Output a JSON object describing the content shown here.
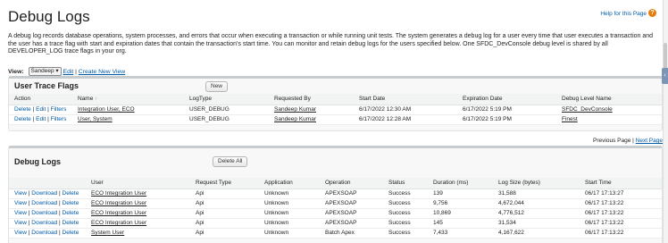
{
  "header": {
    "title": "Debug Logs",
    "help_link": "Help for this Page",
    "help_icon": "help-icon",
    "description": "A debug log records database operations, system processes, and errors that occur when executing a transaction or while running unit tests. The system generates a debug log for a user every time that user executes a transaction and the user has a trace flag with start and expiration dates that contain the transaction's start time. You can monitor and retain debug logs for the users specified below. One SFDC_DevConsole debug level is shared by all DEVELOPER_LOG trace flags in your org."
  },
  "view_bar": {
    "label": "View:",
    "selected": "Sandeep",
    "edit": "Edit",
    "separator": "|",
    "create": "Create New View"
  },
  "trace_flags": {
    "title": "User Trace Flags",
    "new_button": "New",
    "columns": [
      "Action",
      "Name",
      "LogType",
      "Requested By",
      "Start Date",
      "Expiration Date",
      "Debug Level Name"
    ],
    "sort_indicator": "↑",
    "rows": [
      {
        "actions": [
          "Delete",
          "Edit",
          "Filters"
        ],
        "name": "Integration User, ECO",
        "log_type": "USER_DEBUG",
        "requested_by": "Sandeep Kumar",
        "start": "6/17/2022 12:30 AM",
        "expiration": "6/17/2022 5:19 PM",
        "level": "SFDC_DevConsole"
      },
      {
        "actions": [
          "Delete",
          "Edit",
          "Filters"
        ],
        "name": "User, System",
        "log_type": "USER_DEBUG",
        "requested_by": "Sandeep Kumar",
        "start": "6/17/2022 12:28 AM",
        "expiration": "6/17/2022 5:19 PM",
        "level": "Finest"
      }
    ]
  },
  "pager": {
    "previous": "Previous Page",
    "separator": "|",
    "next": "Next Page"
  },
  "debug_logs": {
    "title": "Debug Logs",
    "delete_all_button": "Delete All",
    "columns": [
      "",
      "User",
      "Request Type",
      "Application",
      "Operation",
      "Status",
      "Duration (ms)",
      "Log Size (bytes)",
      "Start Time"
    ],
    "rows": [
      {
        "actions": [
          "View",
          "Download",
          "Delete"
        ],
        "user": "ECO Integration User",
        "request": "Api",
        "app": "Unknown",
        "op": "APEXSOAP",
        "status": "Success",
        "duration": "139",
        "size": "31,588",
        "start": "06/17 17:13:27"
      },
      {
        "actions": [
          "View",
          "Download",
          "Delete"
        ],
        "user": "ECO Integration User",
        "request": "Api",
        "app": "Unknown",
        "op": "APEXSOAP",
        "status": "Success",
        "duration": "9,756",
        "size": "4,672,044",
        "start": "06/17 17:13:22"
      },
      {
        "actions": [
          "View",
          "Download",
          "Delete"
        ],
        "user": "ECO Integration User",
        "request": "Api",
        "app": "Unknown",
        "op": "APEXSOAP",
        "status": "Success",
        "duration": "10,869",
        "size": "4,776,512",
        "start": "06/17 17:13:22"
      },
      {
        "actions": [
          "View",
          "Download",
          "Delete"
        ],
        "user": "ECO Integration User",
        "request": "Api",
        "app": "Unknown",
        "op": "APEXSOAP",
        "status": "Success",
        "duration": "145",
        "size": "31,534",
        "start": "06/17 17:13:22"
      },
      {
        "actions": [
          "View",
          "Download",
          "Delete"
        ],
        "user": "System User",
        "request": "Api",
        "app": "Unknown",
        "op": "Batch Apex",
        "status": "Success",
        "duration": "7,433",
        "size": "4,167,622",
        "start": "06/17 17:13:22"
      }
    ]
  }
}
